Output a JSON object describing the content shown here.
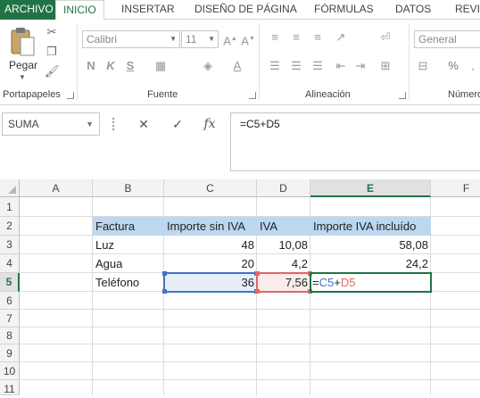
{
  "tabs": [
    "ARCHIVO",
    "INICIO",
    "INSERTAR",
    "DISEÑO DE PÁGINA",
    "FÓRMULAS",
    "DATOS",
    "REVIS"
  ],
  "ribbon": {
    "groups": [
      "Portapapeles",
      "Fuente",
      "Alineación",
      "Número"
    ],
    "paste_label": "Pegar",
    "font_name": "Calibri",
    "font_size": "11",
    "number_format": "General",
    "bold": "N",
    "italic": "K",
    "underline": "S",
    "percent": "%"
  },
  "formula_bar": {
    "name_box": "SUMA",
    "cancel": "✕",
    "enter": "✓",
    "fx": "fx",
    "formula": "=C5+D5"
  },
  "sheet": {
    "columns": [
      "A",
      "B",
      "C",
      "D",
      "E",
      "F"
    ],
    "rows": [
      "1",
      "2",
      "3",
      "4",
      "5",
      "6",
      "7",
      "8",
      "9",
      "10",
      "11"
    ],
    "active_column": "E",
    "active_row": "5",
    "header_row": [
      "Factura",
      "Importe sin IVA",
      "IVA",
      "Importe IVA incluído"
    ],
    "data": [
      {
        "factura": "Luz",
        "importe": "48",
        "iva": "10,08",
        "total": "58,08"
      },
      {
        "factura": "Agua",
        "importe": "20",
        "iva": "4,2",
        "total": "24,2"
      },
      {
        "factura": "Teléfono",
        "importe": "36",
        "iva": "7,56"
      }
    ],
    "editing_formula": {
      "eq": "=",
      "ref1": "C5",
      "op": "+",
      "ref2": "D5"
    }
  },
  "colors": {
    "accent": "#217346",
    "ref_c": "#4472c4",
    "ref_d": "#e06666",
    "header_fill": "#bdd7ee"
  }
}
